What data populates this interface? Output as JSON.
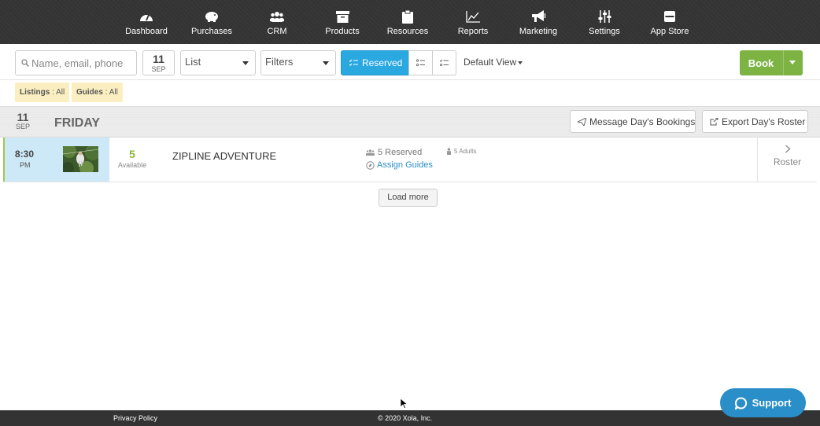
{
  "nav": {
    "items": [
      {
        "label": "Dashboard",
        "icon": "dashboard-icon"
      },
      {
        "label": "Purchases",
        "icon": "piggy-bank-icon"
      },
      {
        "label": "CRM",
        "icon": "users-icon"
      },
      {
        "label": "Products",
        "icon": "archive-box-icon"
      },
      {
        "label": "Resources",
        "icon": "clipboard-icon"
      },
      {
        "label": "Reports",
        "icon": "line-chart-icon"
      },
      {
        "label": "Marketing",
        "icon": "megaphone-icon"
      },
      {
        "label": "Settings",
        "icon": "sliders-icon"
      },
      {
        "label": "App Store",
        "icon": "store-icon"
      }
    ]
  },
  "toolbar": {
    "search_placeholder": "Name, email, phone",
    "date_day": "11",
    "date_month": "SEP",
    "view_select": "List",
    "filters_select": "Filters",
    "reserved_label": "Reserved",
    "default_view": "Default View",
    "book_label": "Book"
  },
  "chips": [
    {
      "key": "Listings",
      "value": ": All"
    },
    {
      "key": "Guides",
      "value": ": All"
    }
  ],
  "day": {
    "day": "11",
    "month": "SEP",
    "weekday": "FRIDAY",
    "message_label": "Message Day's Bookings",
    "export_label": "Export Day's Roster"
  },
  "booking": {
    "time": "8:30",
    "ampm": "PM",
    "available_count": "5",
    "available_label": "Available",
    "title": "ZIPLINE ADVENTURE",
    "reserved": "5 Reserved",
    "assign_guides": "Assign Guides",
    "adults": "5 Adults",
    "roster_label": "Roster"
  },
  "load_more": "Load more",
  "footer": {
    "privacy": "Privacy Policy",
    "copyright": "© 2020 Xola, Inc."
  },
  "support_label": "Support",
  "colors": {
    "nav_bg": "#333333",
    "accent_blue": "#2aa8e0",
    "book_green": "#7cb342",
    "available_green": "#8ab534",
    "link_blue": "#2a8ec8",
    "chip_bg": "#fbeec0",
    "time_cell_bg": "#cde8f6"
  }
}
